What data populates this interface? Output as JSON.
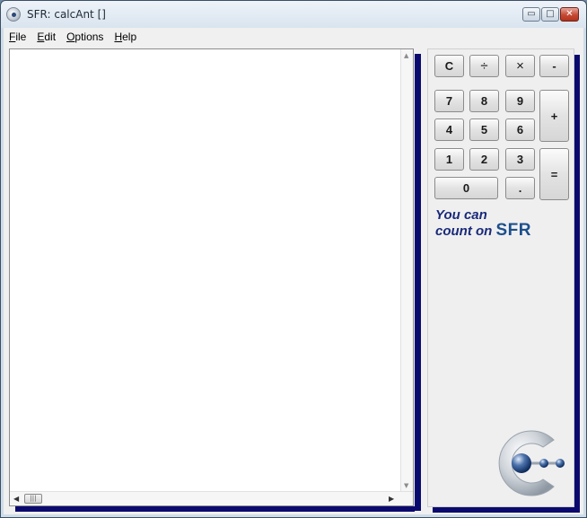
{
  "window": {
    "title": "SFR: calcAnt []",
    "minimize_glyph": "▭",
    "maximize_glyph": "□",
    "close_glyph": "✕"
  },
  "menu": {
    "items": [
      {
        "label": "File",
        "underline": "F"
      },
      {
        "label": "Edit",
        "underline": "E"
      },
      {
        "label": "Options",
        "underline": "O"
      },
      {
        "label": "Help",
        "underline": "H"
      }
    ]
  },
  "editor": {
    "value": "",
    "thumb_glyph": "|||",
    "up_arrow": "▲",
    "down_arrow": "▼",
    "left_arrow": "◀",
    "right_arrow": "▶"
  },
  "calculator": {
    "keys": {
      "clear": "C",
      "divide": "÷",
      "multiply": "×",
      "minus": "-",
      "seven": "7",
      "eight": "8",
      "nine": "9",
      "plus": "+",
      "four": "4",
      "five": "5",
      "six": "6",
      "one": "1",
      "two": "2",
      "three": "3",
      "equals": "=",
      "zero": "0",
      "dot": "."
    },
    "slogan_line1": "You can",
    "slogan_line2": "count on",
    "brand": "SFR"
  },
  "colors": {
    "shadow": "#0a0a6e",
    "slogan": "#1a2a7a",
    "brand": "#1c4f8c"
  },
  "icons": {
    "app": "sfr-logo-icon",
    "logo": "sfr-logo-icon"
  }
}
